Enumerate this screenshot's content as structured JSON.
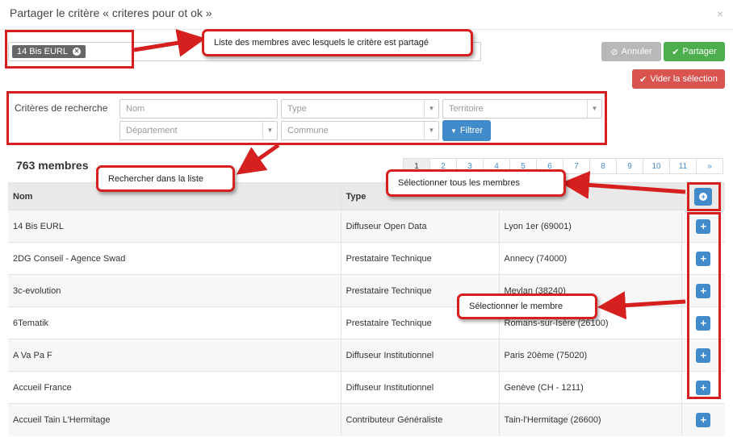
{
  "modal": {
    "title": "Partager le critère « criteres pour ot ok »",
    "close": "×"
  },
  "shared_tag": {
    "label": "14 Bis EURL",
    "remove_icon": "✕"
  },
  "buttons": {
    "cancel": "Annuler",
    "cancel_icon": "⊘",
    "share": "Partager",
    "share_icon": "✔",
    "clear": "Vider la sélection",
    "clear_icon": "✔",
    "filter": "Filtrer",
    "filter_icon": "▼"
  },
  "search": {
    "label": "Critères de recherche",
    "nom_placeholder": "Nom",
    "type_placeholder": "Type",
    "territoire_placeholder": "Territoire",
    "departement_placeholder": "Département",
    "commune_placeholder": "Commune"
  },
  "members_count": "763 membres",
  "pagination": [
    "1",
    "2",
    "3",
    "4",
    "5",
    "6",
    "7",
    "8",
    "9",
    "10",
    "11",
    "»"
  ],
  "pagination_active": "1",
  "table": {
    "headers": {
      "nom": "Nom",
      "type": "Type"
    },
    "rows": [
      {
        "nom": "14 Bis EURL",
        "type": "Diffuseur Open Data",
        "loc": "Lyon 1er (69001)"
      },
      {
        "nom": "2DG Conseil - Agence Swad",
        "type": "Prestataire Technique",
        "loc": "Annecy (74000)"
      },
      {
        "nom": "3c-evolution",
        "type": "Prestataire Technique",
        "loc": "Meylan (38240)"
      },
      {
        "nom": "6Tematik",
        "type": "Prestataire Technique",
        "loc": "Romans-sur-Isère (26100)"
      },
      {
        "nom": "A Va Pa F",
        "type": "Diffuseur Institutionnel",
        "loc": "Paris 20ème (75020)"
      },
      {
        "nom": "Accueil France",
        "type": "Diffuseur Institutionnel",
        "loc": "Genève (CH - 1211)"
      },
      {
        "nom": "Accueil Tain L'Hermitage",
        "type": "Contributeur Généraliste",
        "loc": "Tain-l'Hermitage (26600)"
      }
    ],
    "add_icon": "+"
  },
  "annotations": {
    "shared_list": "Liste des membres avec lesquels le critère est partagé",
    "search_list": "Rechercher dans la liste",
    "select_all": "Sélectionner tous les membres",
    "select_member": "Sélectionner le membre"
  },
  "colors": {
    "primary": "#428bca",
    "success": "#4cae4c",
    "danger": "#d9534f",
    "annotation": "#d61f1f"
  }
}
